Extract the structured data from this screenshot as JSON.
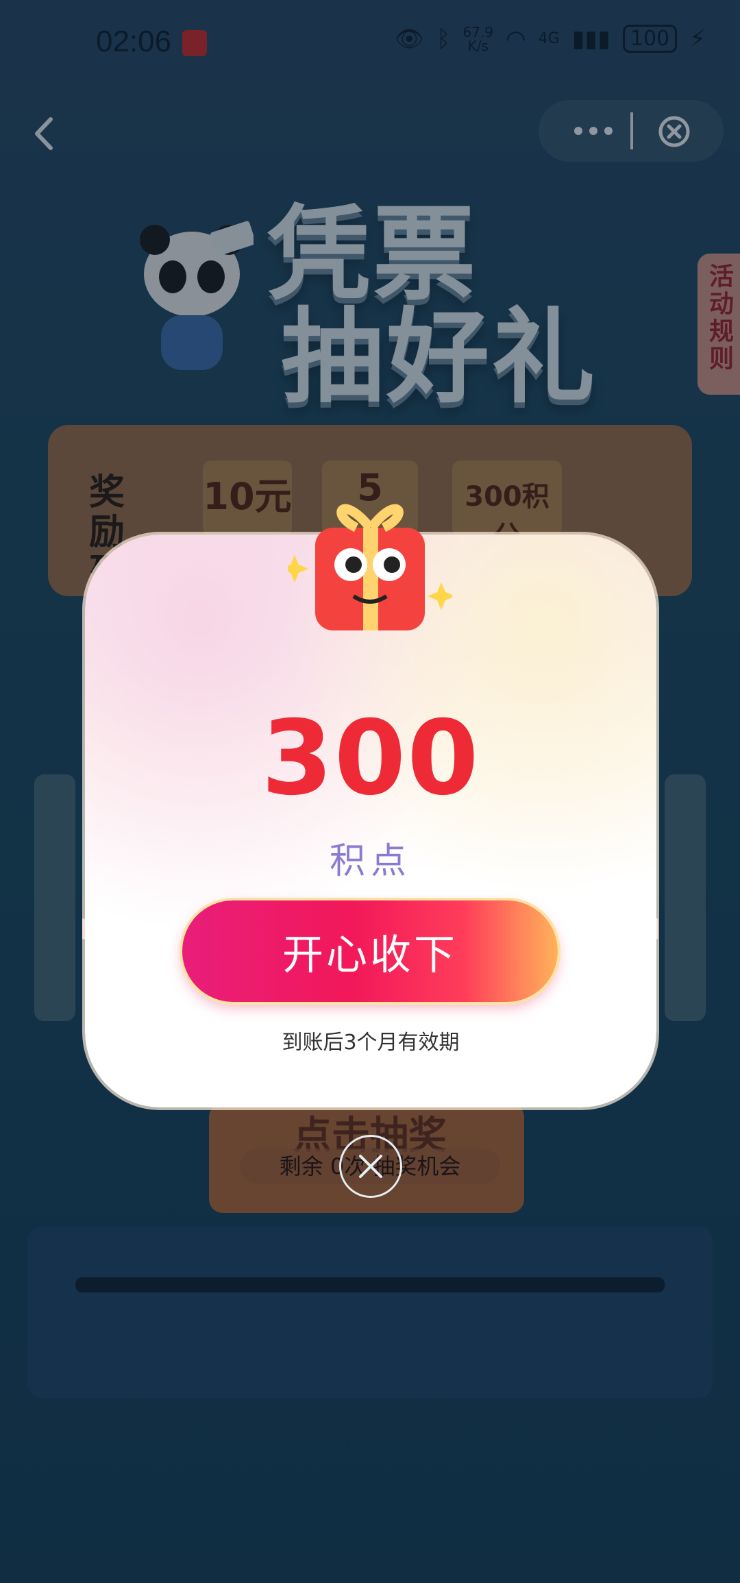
{
  "status_bar": {
    "time": "02:06",
    "network_speed": "67.9\nK/s",
    "signal": "4G",
    "battery": "100"
  },
  "nav": {
    "back_icon": "chevron-left-icon",
    "more_icon": "more-dots-icon",
    "close_icon": "close-circle-icon"
  },
  "banner": {
    "title_line1": "凭票",
    "title_line2": "抽好礼"
  },
  "rules_tab": "活动规则",
  "reward_list": {
    "label": "奖励列表",
    "items": [
      "10元",
      "5",
      "300积分"
    ]
  },
  "machine": {
    "draw_button": "点击抽奖",
    "remaining": "剩余 0次 抽奖机会"
  },
  "modal": {
    "amount": "300",
    "unit": "积点",
    "accept_label": "开心收下",
    "validity": "到账后3个月有效期"
  },
  "colors": {
    "amount": "#ee2a36",
    "unit": "#8b7bd0",
    "button_start": "#e91e7a",
    "button_end": "#ffb35a"
  }
}
